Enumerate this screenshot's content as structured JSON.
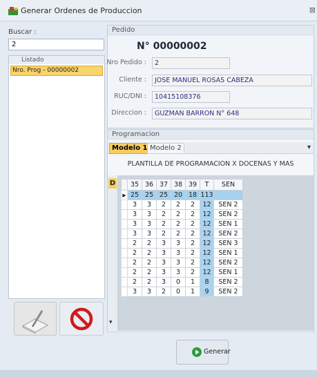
{
  "window": {
    "title": "Generar Ordenes de Produccion",
    "close": "⊠"
  },
  "left": {
    "search_label": "Buscar :",
    "search_value": "2",
    "listado_label": "Listado",
    "items": [
      {
        "label": "Nro. Prog - 00000002"
      }
    ]
  },
  "pedido": {
    "section": "Pedido",
    "number": "N° 00000002",
    "nro_label": "Nro Pedido :",
    "nro_value": "2",
    "cliente_label": "Cliente :",
    "cliente_value": "JOSE MANUEL ROSAS CABEZA",
    "ruc_label": "RUC/DNI :",
    "ruc_value": "10415108376",
    "dir_label": "Direccion :",
    "dir_value": "GUZMAN BARRON N° 648"
  },
  "programacion": {
    "section": "Programacion",
    "tabs": [
      "Modelo 1",
      "Modelo 2"
    ],
    "template_title": "PLANTILLA DE PROGRAMACION X DOCENAS Y MAS",
    "d_label": "D",
    "headers": [
      "35",
      "36",
      "37",
      "38",
      "39",
      "T",
      "SEN"
    ],
    "total_row": [
      "25",
      "25",
      "25",
      "20",
      "18",
      "113",
      ""
    ],
    "rows": [
      [
        "3",
        "3",
        "2",
        "2",
        "2",
        "12",
        "SEN 2"
      ],
      [
        "3",
        "3",
        "2",
        "2",
        "2",
        "12",
        "SEN 2"
      ],
      [
        "3",
        "3",
        "2",
        "2",
        "2",
        "12",
        "SEN 1"
      ],
      [
        "3",
        "3",
        "2",
        "2",
        "2",
        "12",
        "SEN 2"
      ],
      [
        "2",
        "2",
        "3",
        "3",
        "2",
        "12",
        "SEN 3"
      ],
      [
        "2",
        "2",
        "3",
        "3",
        "2",
        "12",
        "SEN 1"
      ],
      [
        "2",
        "2",
        "3",
        "3",
        "2",
        "12",
        "SEN 2"
      ],
      [
        "2",
        "2",
        "3",
        "3",
        "2",
        "12",
        "SEN 1"
      ],
      [
        "2",
        "2",
        "3",
        "0",
        "1",
        "8",
        "SEN 2"
      ],
      [
        "3",
        "3",
        "2",
        "0",
        "1",
        "9",
        "SEN 2"
      ]
    ]
  },
  "actions": {
    "generate": "Generar"
  },
  "colors": {
    "accent_tab": "#f7cd5f",
    "total_row": "#a5d1ee",
    "selected_item": "#f9d36b"
  }
}
